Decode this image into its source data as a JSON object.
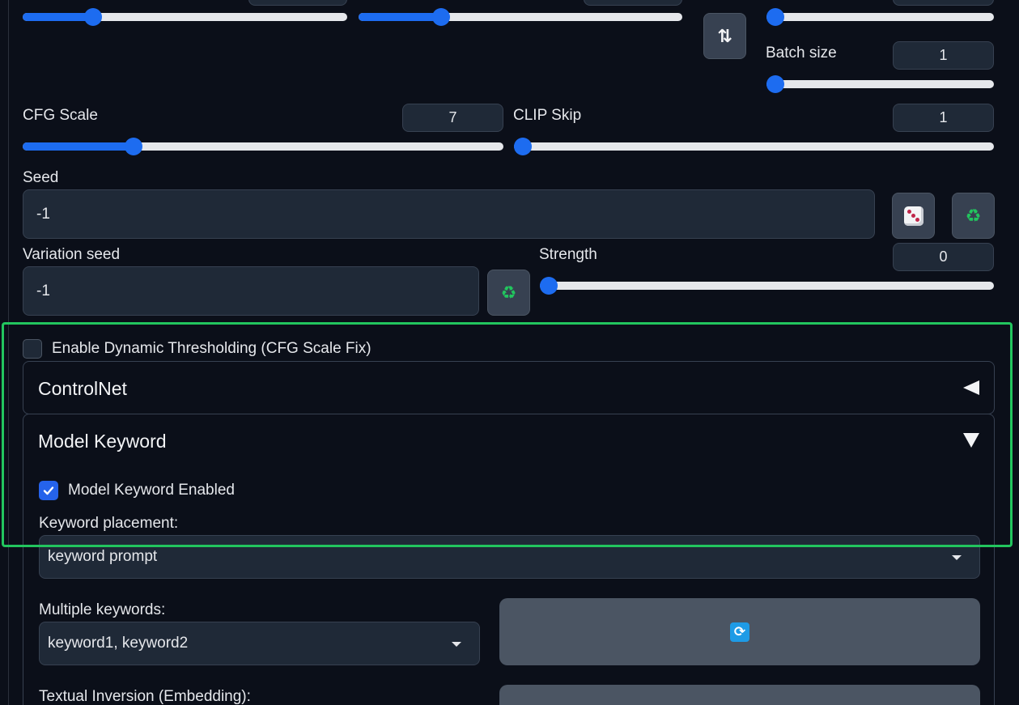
{
  "sliders": {
    "top_left": {
      "value": 0.2
    },
    "top_middle": {
      "value": 0.24
    },
    "top_right": {
      "value": 0
    },
    "batch_size": {
      "label": "Batch size",
      "value": "1",
      "level": 0
    },
    "cfg_scale": {
      "label": "CFG Scale",
      "value": "7",
      "level": 0.22
    },
    "clip_skip": {
      "label": "CLIP Skip",
      "value": "1",
      "level": 0
    },
    "strength": {
      "label": "Strength",
      "value": "0",
      "level": 0
    }
  },
  "seed": {
    "label": "Seed",
    "value": "-1"
  },
  "variation_seed": {
    "label": "Variation seed",
    "value": "-1"
  },
  "icons": {
    "swap": "swap-dimensions-icon",
    "dice": "dice-icon",
    "recycle": "recycle-icon",
    "refresh": "refresh-icon"
  },
  "glyphs": {
    "swap": "⇅",
    "recycle": "♻",
    "refresh": "⟳"
  },
  "dynamic_thresholding": {
    "label": "Enable Dynamic Thresholding (CFG Scale Fix)",
    "checked": false
  },
  "controlnet": {
    "title": "ControlNet",
    "expanded": false
  },
  "model_keyword": {
    "title": "Model Keyword",
    "expanded": true,
    "enabled_label": "Model Keyword Enabled",
    "enabled": true,
    "placement_label": "Keyword placement:",
    "placement_value": "keyword prompt",
    "multiple_label": "Multiple keywords:",
    "multiple_value": "keyword1, keyword2",
    "textual_inversion_label": "Textual Inversion (Embedding):"
  },
  "colors": {
    "background": "#0b0f19",
    "accent": "#1d6cf0",
    "highlight": "#22c55e"
  }
}
